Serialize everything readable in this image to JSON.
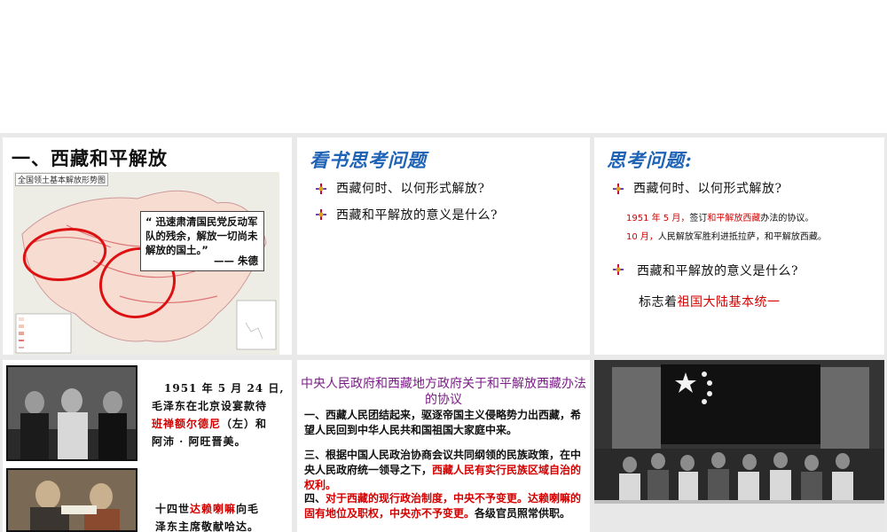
{
  "slide1": {
    "title": "一、西藏和平解放",
    "map_title": "全国领土基本解放形势图",
    "quote": "“ 迅速肃清国民党反动军队的残余，解放一切尚未解放的国土。”",
    "quote_source": "—— 朱德"
  },
  "slide2": {
    "heading": "看书思考问题",
    "questions": [
      "西藏何时、以何形式解放?",
      "西藏和平解放的意义是什么?"
    ]
  },
  "slide3": {
    "heading": "思考问题:",
    "q1": "西藏何时、以何形式解放?",
    "a1_red": "1951 年 5 月，",
    "a1_mid": "签订",
    "a1_red2": "和平解放西藏",
    "a1_end": "办法的协议。",
    "a2_red": "10 月，",
    "a2_end": "人民解放军胜利进抵拉萨，和平解放西藏。",
    "q2": "西藏和平解放的意义是什么?",
    "a3_pre": "标志着",
    "a3_red": "祖国大陆基本统一"
  },
  "slide4": {
    "caption1_line1": "1951 年 5 月 24 日,",
    "caption1_line2": "毛泽东在北京设宴款待",
    "caption1_red": "班禅额尔德尼",
    "caption1_line3b": "（左）和",
    "caption1_line4": "阿沛 · 阿旺晋美。",
    "caption2_pre": "十四世",
    "caption2_red": "达赖喇嘛",
    "caption2_post": "向毛",
    "caption2_line2": "泽东主席敬献哈达。"
  },
  "slide5": {
    "title": "中央人民政府和西藏地方政府关于和平解放西藏办法的协议",
    "p1": "一、西藏人民团结起来，驱逐帝国主义侵略势力出西藏，希望人民回到中华人民共和国祖国大家庭中来。",
    "p3": "三、根据中国人民政治协商会议共同纲领的民族政策，在中央人民政府统一领导之下，",
    "p3_red": "西藏人民有实行民族区域自治的权利。",
    "p4_pre": "四、",
    "p4_red": "对于西藏的现行政治制度，中央不予变更。达赖喇嘛的固有地位及职权，中央亦不予变更。",
    "p4_post": "各级官员照常供职。"
  },
  "colors": {
    "heading_blue": "#1f63b6",
    "red": "#d40000",
    "purple": "#7b1e87"
  }
}
